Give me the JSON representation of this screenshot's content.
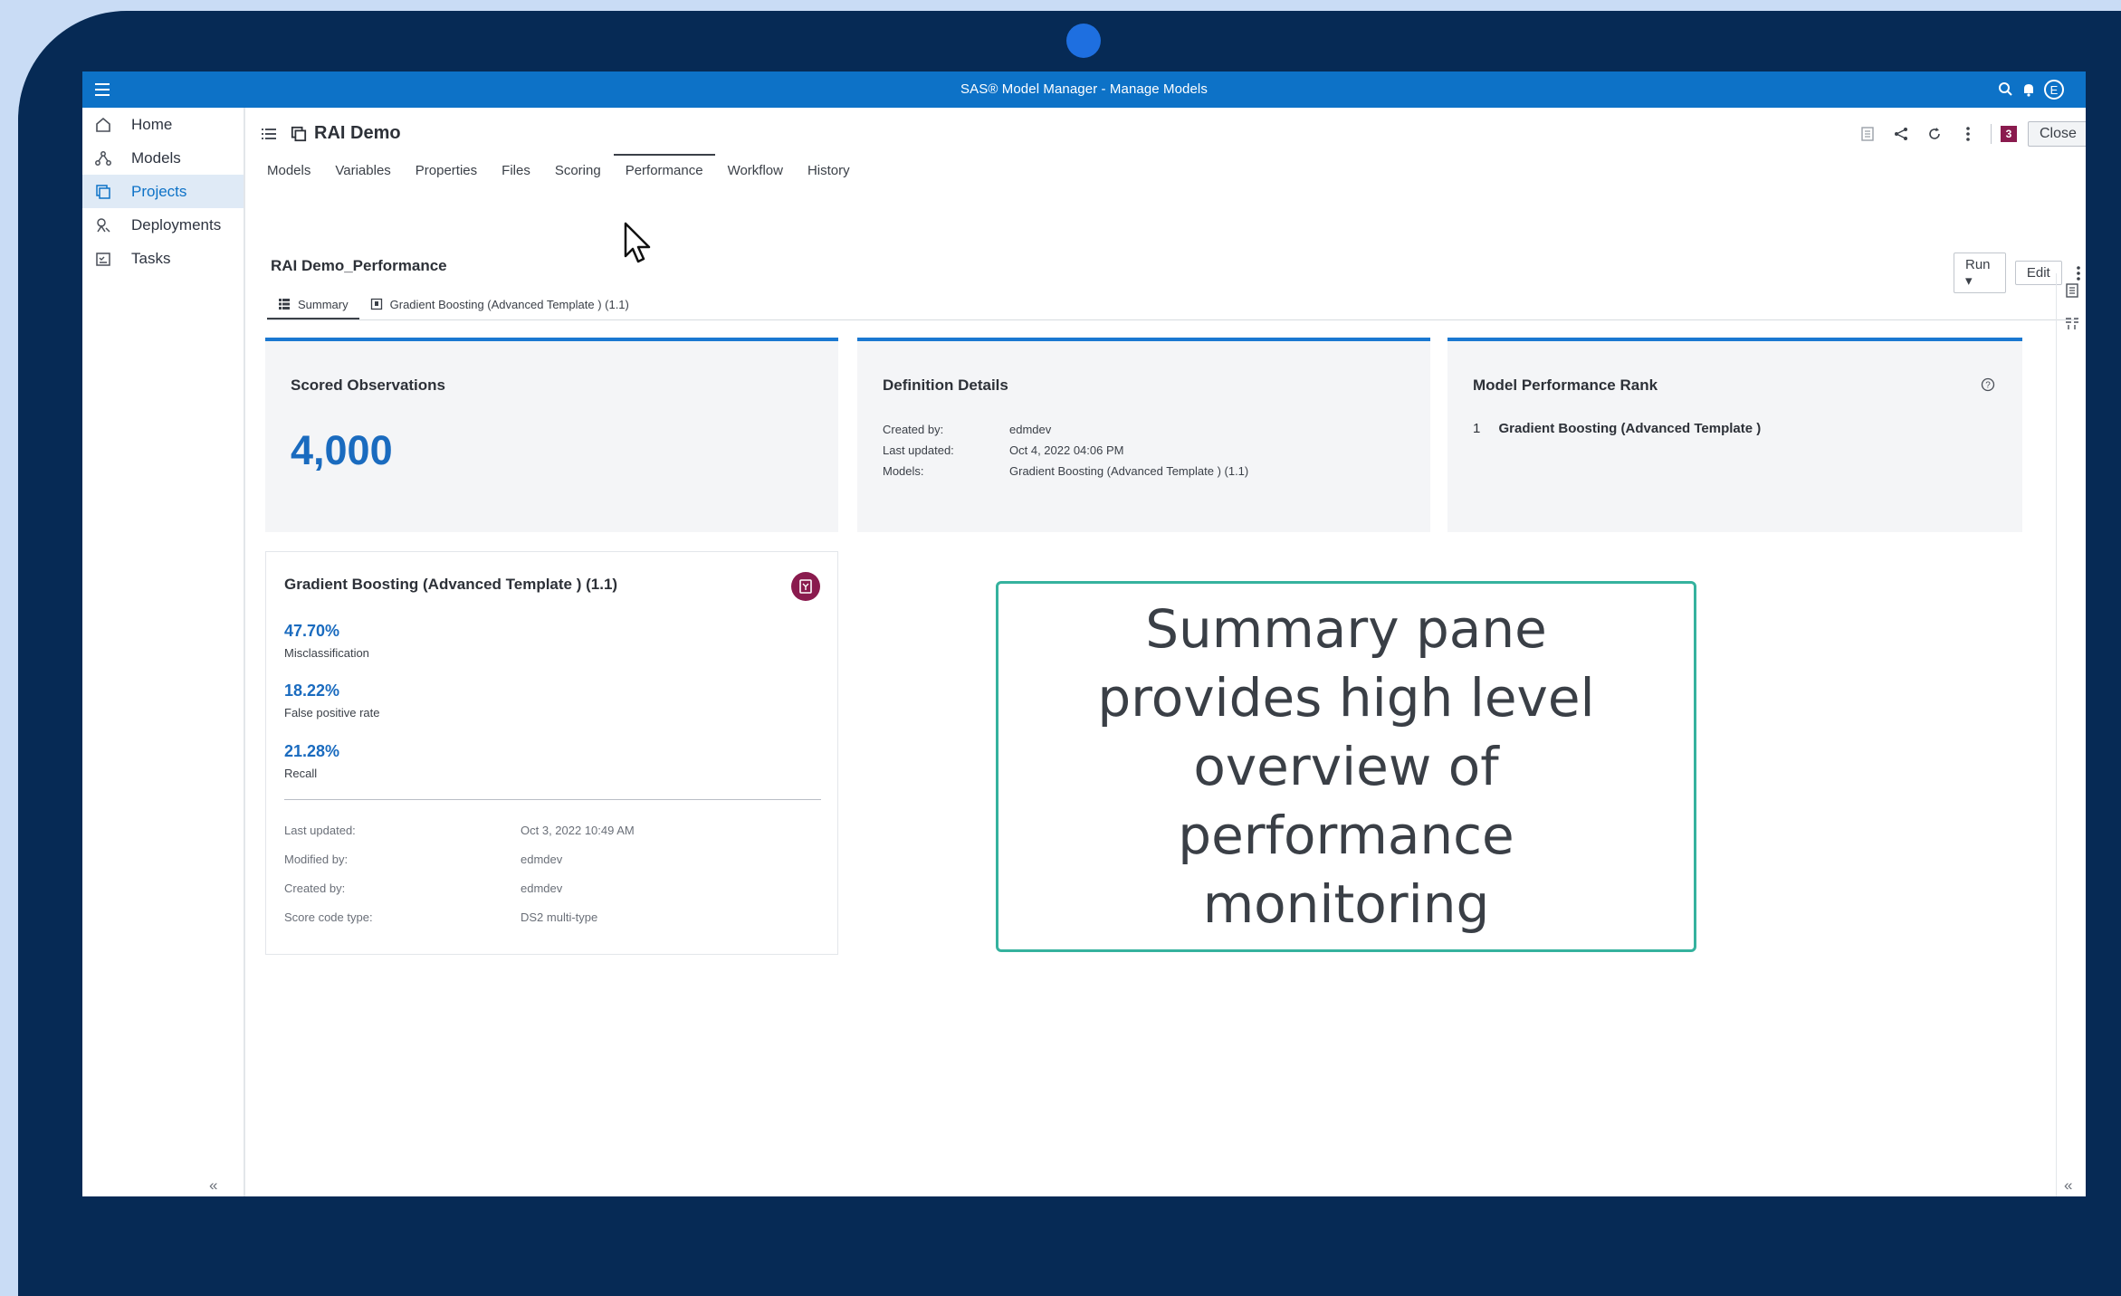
{
  "app": {
    "title": "SAS® Model Manager - Manage Models",
    "avatar_letter": "E"
  },
  "sidebar": {
    "items": [
      {
        "label": "Home",
        "icon": "home-icon"
      },
      {
        "label": "Models",
        "icon": "models-icon"
      },
      {
        "label": "Projects",
        "icon": "projects-icon"
      },
      {
        "label": "Deployments",
        "icon": "deployments-icon"
      },
      {
        "label": "Tasks",
        "icon": "tasks-icon"
      }
    ],
    "active": "Projects",
    "collapse_glyph": "«"
  },
  "project": {
    "title": "RAI Demo",
    "badge_count": "3",
    "close_label": "Close"
  },
  "tabs": [
    "Models",
    "Variables",
    "Properties",
    "Files",
    "Scoring",
    "Performance",
    "Workflow",
    "History"
  ],
  "active_tab": "Performance",
  "pane": {
    "title": "RAI Demo_Performance",
    "run_label": "Run ▾",
    "edit_label": "Edit"
  },
  "subtabs": [
    {
      "label": "Summary",
      "icon": "summary-icon"
    },
    {
      "label": "Gradient Boosting (Advanced Template ) (1.1)",
      "icon": "model-icon"
    }
  ],
  "cards": {
    "scored": {
      "title": "Scored Observations",
      "value": "4,000"
    },
    "definition": {
      "title": "Definition Details",
      "rows": [
        {
          "k": "Created by:",
          "v": "edmdev"
        },
        {
          "k": "Last updated:",
          "v": "Oct 4, 2022 04:06 PM"
        },
        {
          "k": "Models:",
          "v": "Gradient Boosting (Advanced Template ) (1.1)"
        }
      ]
    },
    "rank": {
      "title": "Model Performance Rank",
      "rank_no": "1",
      "rank_model": "Gradient Boosting (Advanced Template )"
    }
  },
  "model_card": {
    "title": "Gradient Boosting (Advanced Template ) (1.1)",
    "metrics": [
      {
        "value": "47.70%",
        "label": "Misclassification"
      },
      {
        "value": "18.22%",
        "label": "False positive rate"
      },
      {
        "value": "21.28%",
        "label": "Recall"
      }
    ],
    "details": [
      {
        "k": "Last updated:",
        "v": "Oct 3, 2022 10:49 AM"
      },
      {
        "k": "Modified by:",
        "v": "edmdev"
      },
      {
        "k": "Created by:",
        "v": "edmdev"
      },
      {
        "k": "Score code type:",
        "v": "DS2 multi-type"
      }
    ]
  },
  "callout": {
    "text": "Summary pane provides high level overview of performance monitoring"
  },
  "colors": {
    "topbar": "#0d72c7",
    "accent": "#1a78d1",
    "badge": "#8a1b4e",
    "callout_border": "#35b29e",
    "bezel": "#062a55"
  }
}
